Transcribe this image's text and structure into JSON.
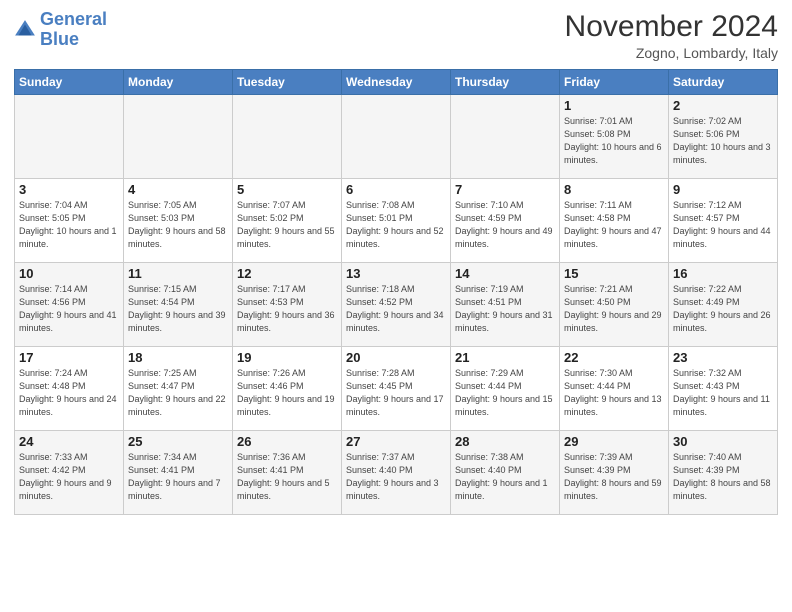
{
  "header": {
    "logo_line1": "General",
    "logo_line2": "Blue",
    "month": "November 2024",
    "location": "Zogno, Lombardy, Italy"
  },
  "weekdays": [
    "Sunday",
    "Monday",
    "Tuesday",
    "Wednesday",
    "Thursday",
    "Friday",
    "Saturday"
  ],
  "weeks": [
    [
      {
        "day": "",
        "info": ""
      },
      {
        "day": "",
        "info": ""
      },
      {
        "day": "",
        "info": ""
      },
      {
        "day": "",
        "info": ""
      },
      {
        "day": "",
        "info": ""
      },
      {
        "day": "1",
        "info": "Sunrise: 7:01 AM\nSunset: 5:08 PM\nDaylight: 10 hours and 6 minutes."
      },
      {
        "day": "2",
        "info": "Sunrise: 7:02 AM\nSunset: 5:06 PM\nDaylight: 10 hours and 3 minutes."
      }
    ],
    [
      {
        "day": "3",
        "info": "Sunrise: 7:04 AM\nSunset: 5:05 PM\nDaylight: 10 hours and 1 minute."
      },
      {
        "day": "4",
        "info": "Sunrise: 7:05 AM\nSunset: 5:03 PM\nDaylight: 9 hours and 58 minutes."
      },
      {
        "day": "5",
        "info": "Sunrise: 7:07 AM\nSunset: 5:02 PM\nDaylight: 9 hours and 55 minutes."
      },
      {
        "day": "6",
        "info": "Sunrise: 7:08 AM\nSunset: 5:01 PM\nDaylight: 9 hours and 52 minutes."
      },
      {
        "day": "7",
        "info": "Sunrise: 7:10 AM\nSunset: 4:59 PM\nDaylight: 9 hours and 49 minutes."
      },
      {
        "day": "8",
        "info": "Sunrise: 7:11 AM\nSunset: 4:58 PM\nDaylight: 9 hours and 47 minutes."
      },
      {
        "day": "9",
        "info": "Sunrise: 7:12 AM\nSunset: 4:57 PM\nDaylight: 9 hours and 44 minutes."
      }
    ],
    [
      {
        "day": "10",
        "info": "Sunrise: 7:14 AM\nSunset: 4:56 PM\nDaylight: 9 hours and 41 minutes."
      },
      {
        "day": "11",
        "info": "Sunrise: 7:15 AM\nSunset: 4:54 PM\nDaylight: 9 hours and 39 minutes."
      },
      {
        "day": "12",
        "info": "Sunrise: 7:17 AM\nSunset: 4:53 PM\nDaylight: 9 hours and 36 minutes."
      },
      {
        "day": "13",
        "info": "Sunrise: 7:18 AM\nSunset: 4:52 PM\nDaylight: 9 hours and 34 minutes."
      },
      {
        "day": "14",
        "info": "Sunrise: 7:19 AM\nSunset: 4:51 PM\nDaylight: 9 hours and 31 minutes."
      },
      {
        "day": "15",
        "info": "Sunrise: 7:21 AM\nSunset: 4:50 PM\nDaylight: 9 hours and 29 minutes."
      },
      {
        "day": "16",
        "info": "Sunrise: 7:22 AM\nSunset: 4:49 PM\nDaylight: 9 hours and 26 minutes."
      }
    ],
    [
      {
        "day": "17",
        "info": "Sunrise: 7:24 AM\nSunset: 4:48 PM\nDaylight: 9 hours and 24 minutes."
      },
      {
        "day": "18",
        "info": "Sunrise: 7:25 AM\nSunset: 4:47 PM\nDaylight: 9 hours and 22 minutes."
      },
      {
        "day": "19",
        "info": "Sunrise: 7:26 AM\nSunset: 4:46 PM\nDaylight: 9 hours and 19 minutes."
      },
      {
        "day": "20",
        "info": "Sunrise: 7:28 AM\nSunset: 4:45 PM\nDaylight: 9 hours and 17 minutes."
      },
      {
        "day": "21",
        "info": "Sunrise: 7:29 AM\nSunset: 4:44 PM\nDaylight: 9 hours and 15 minutes."
      },
      {
        "day": "22",
        "info": "Sunrise: 7:30 AM\nSunset: 4:44 PM\nDaylight: 9 hours and 13 minutes."
      },
      {
        "day": "23",
        "info": "Sunrise: 7:32 AM\nSunset: 4:43 PM\nDaylight: 9 hours and 11 minutes."
      }
    ],
    [
      {
        "day": "24",
        "info": "Sunrise: 7:33 AM\nSunset: 4:42 PM\nDaylight: 9 hours and 9 minutes."
      },
      {
        "day": "25",
        "info": "Sunrise: 7:34 AM\nSunset: 4:41 PM\nDaylight: 9 hours and 7 minutes."
      },
      {
        "day": "26",
        "info": "Sunrise: 7:36 AM\nSunset: 4:41 PM\nDaylight: 9 hours and 5 minutes."
      },
      {
        "day": "27",
        "info": "Sunrise: 7:37 AM\nSunset: 4:40 PM\nDaylight: 9 hours and 3 minutes."
      },
      {
        "day": "28",
        "info": "Sunrise: 7:38 AM\nSunset: 4:40 PM\nDaylight: 9 hours and 1 minute."
      },
      {
        "day": "29",
        "info": "Sunrise: 7:39 AM\nSunset: 4:39 PM\nDaylight: 8 hours and 59 minutes."
      },
      {
        "day": "30",
        "info": "Sunrise: 7:40 AM\nSunset: 4:39 PM\nDaylight: 8 hours and 58 minutes."
      }
    ]
  ]
}
